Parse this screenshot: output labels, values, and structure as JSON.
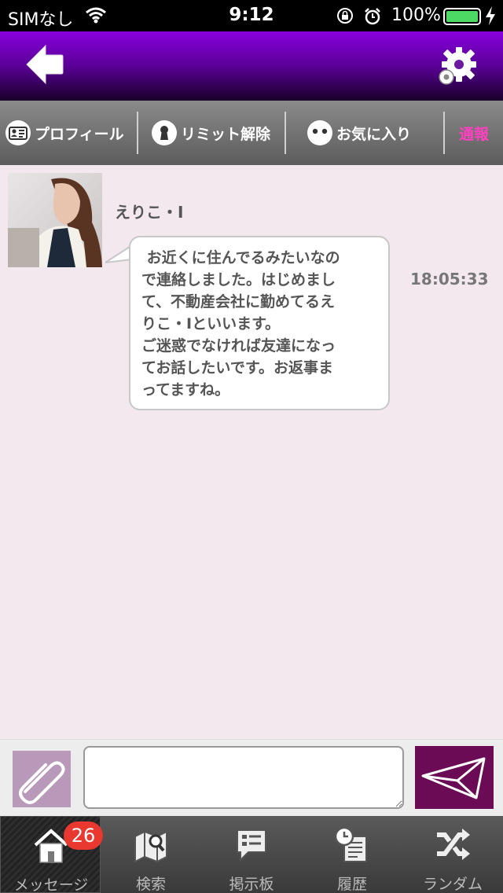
{
  "status_bar": {
    "carrier": "SIMなし",
    "time": "9:12",
    "battery_percent": "100%",
    "battery_level": 1.0
  },
  "nav": {
    "back_icon": "back-arrow-icon",
    "settings_icon": "gear-icon"
  },
  "actions": {
    "profile_label": "プロフィール",
    "limit_label": "リミット解除",
    "favorite_label": "お気に入り",
    "report_label": "通報",
    "report_color": "#ff40c0"
  },
  "chat": {
    "sender": "えりこ・I",
    "message": " お近くに住んでるみたいなの\nで連絡しました。はじめまし\nて、不動産会社に勤めてるえ\nりこ・Iといいます。\nご迷惑でなければ友達になっ\nてお話したいです。お返事ま\nってますね。",
    "timestamp": "18:05:33"
  },
  "input": {
    "value": "",
    "attach_icon": "paperclip-icon",
    "send_icon": "envelope-icon",
    "send_color": "#6b0b55"
  },
  "tabs": [
    {
      "label": "メッセージ",
      "badge": "26",
      "icon": "home-icon"
    },
    {
      "label": "検索",
      "icon": "map-search-icon"
    },
    {
      "label": "掲示板",
      "icon": "board-icon"
    },
    {
      "label": "履歴",
      "icon": "history-icon"
    },
    {
      "label": "ランダム",
      "icon": "shuffle-icon"
    }
  ],
  "colors": {
    "nav_top": "#8800dd",
    "chat_bg": "#f2e8ee"
  }
}
